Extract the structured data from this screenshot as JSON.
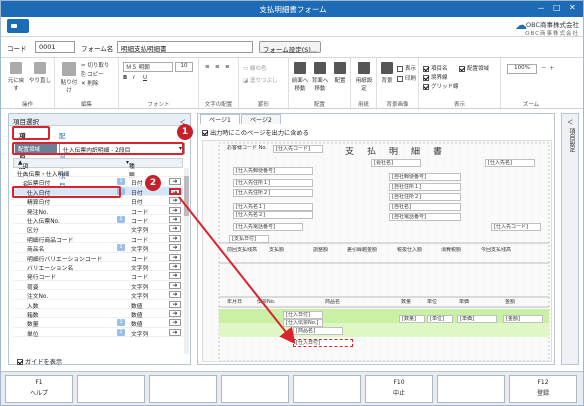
{
  "window": {
    "title": "支払明細書フォーム"
  },
  "brand": {
    "name": "OBC商事株式会社",
    "sub": "OBC商事株式会社"
  },
  "codebar": {
    "code_label": "コード",
    "code_value": "0001",
    "form_label": "フォーム名",
    "form_value": "明細支払明細書",
    "settings_button": "フォーム設定(S)..."
  },
  "ribbon": {
    "groups": [
      {
        "label": "操作",
        "items": [
          "元に戻す",
          "やり直し"
        ]
      },
      {
        "label": "編集",
        "items": [
          "貼り付け",
          "切り取り",
          "コピー",
          "削除"
        ]
      },
      {
        "label": "フォント",
        "items": [
          "ＭＳ 明朝",
          "10"
        ]
      },
      {
        "label": "文字の配置",
        "items": []
      },
      {
        "label": "罫形",
        "items": [
          "線の色",
          "塗りつぶし"
        ]
      },
      {
        "label": "配置",
        "items": [
          "前面へ移動",
          "背面へ移動",
          "配置"
        ]
      },
      {
        "label": "用紙",
        "items": [
          "用紙設定"
        ]
      },
      {
        "label": "背景画像",
        "items": [
          "背景",
          "表示",
          "印刷"
        ]
      },
      {
        "label": "表示",
        "items": [
          "項目名",
          "配置領域",
          "境界線",
          "グリッド線"
        ]
      },
      {
        "label": "ズーム",
        "items": [
          "100%"
        ]
      }
    ]
  },
  "left_pane": {
    "header": "項目選択",
    "tabs": [
      "項目追加",
      "配置済み項目"
    ],
    "area_label": "配置領域",
    "area_value": "仕入伝票内訳明細 - 2段目",
    "columns": [
      "項目名",
      "種類"
    ],
    "rows": [
      {
        "name": "仕入伝票・仕入明細",
        "type": "",
        "badge": "",
        "indent": 0,
        "arrow": false
      },
      {
        "name": "伝票日付",
        "type": "日付",
        "badge": "1",
        "indent": 1,
        "arrow": true
      },
      {
        "name": "仕入日付",
        "type": "日付",
        "badge": "1",
        "indent": 1,
        "arrow": true
      },
      {
        "name": "精算日付",
        "type": "日付",
        "badge": "",
        "indent": 1,
        "arrow": true
      },
      {
        "name": "発注No.",
        "type": "コード",
        "badge": "",
        "indent": 1,
        "arrow": true
      },
      {
        "name": "仕入伝票No.",
        "type": "コード",
        "badge": "1",
        "indent": 1,
        "arrow": true
      },
      {
        "name": "区分",
        "type": "文字列",
        "badge": "",
        "indent": 1,
        "arrow": true
      },
      {
        "name": "明細行商品コード",
        "type": "コード",
        "badge": "",
        "indent": 1,
        "arrow": true
      },
      {
        "name": "商品名",
        "type": "文字列",
        "badge": "1",
        "indent": 1,
        "arrow": true
      },
      {
        "name": "明細行バリエーションコード",
        "type": "コード",
        "badge": "",
        "indent": 1,
        "arrow": true
      },
      {
        "name": "バリエーション名",
        "type": "文字列",
        "badge": "",
        "indent": 1,
        "arrow": true
      },
      {
        "name": "発行コード",
        "type": "コード",
        "badge": "",
        "indent": 1,
        "arrow": true
      },
      {
        "name": "荷姿",
        "type": "文字列",
        "badge": "",
        "indent": 1,
        "arrow": true
      },
      {
        "name": "注文No.",
        "type": "文字列",
        "badge": "",
        "indent": 1,
        "arrow": true
      },
      {
        "name": "入数",
        "type": "数値",
        "badge": "",
        "indent": 1,
        "arrow": true
      },
      {
        "name": "箱数",
        "type": "数値",
        "badge": "",
        "indent": 1,
        "arrow": true
      },
      {
        "name": "数量",
        "type": "数値",
        "badge": "1",
        "indent": 1,
        "arrow": true
      },
      {
        "name": "単位",
        "type": "文字列",
        "badge": "1",
        "indent": 1,
        "arrow": true
      }
    ],
    "guide_label": "ガイドを表示"
  },
  "right_pane": {
    "tabs": [
      "ページ1",
      "ページ2"
    ],
    "checkbox": "出力時にこのページを出力に含める"
  },
  "form": {
    "title": "支　払　明　細　書",
    "fields": [
      "お客様コード No.",
      "[仕入先コード]",
      "[会社名]",
      "[仕入先名]",
      "[仕入先郵便番号]",
      "[仕入先住所１]",
      "[仕入先住所２]",
      "[仕入先名１]",
      "[仕入先名２]",
      "[仕入先電話番号]",
      "[自社郵便番号]",
      "[自社住所１]",
      "[自社住所２]",
      "[自社名]",
      "[自社電話番号]",
      "[支払日付]",
      "前回支払残高",
      "支払額",
      "調整額",
      "差引繰越金額",
      "税抜仕入額",
      "消費税額",
      "今回支払残高",
      "年月日",
      "伝票No.",
      "商品名",
      "数量",
      "単位",
      "単価",
      "金額",
      "[仕入日付]",
      "[仕入伝票No.]",
      "[商品名]",
      "[数量]",
      "[単位]",
      "[単価]",
      "[金額]",
      "[仕入先コード]",
      "[支払予定日]"
    ]
  },
  "sidebar": {
    "label": "項目設定"
  },
  "fkeys": [
    {
      "key": "F1",
      "label": "ヘルプ"
    },
    {
      "key": "",
      "label": ""
    },
    {
      "key": "",
      "label": ""
    },
    {
      "key": "",
      "label": ""
    },
    {
      "key": "",
      "label": ""
    },
    {
      "key": "F10",
      "label": "中止"
    },
    {
      "key": "",
      "label": ""
    },
    {
      "key": "F12",
      "label": "登録"
    }
  ],
  "callouts": [
    "1",
    "2"
  ]
}
